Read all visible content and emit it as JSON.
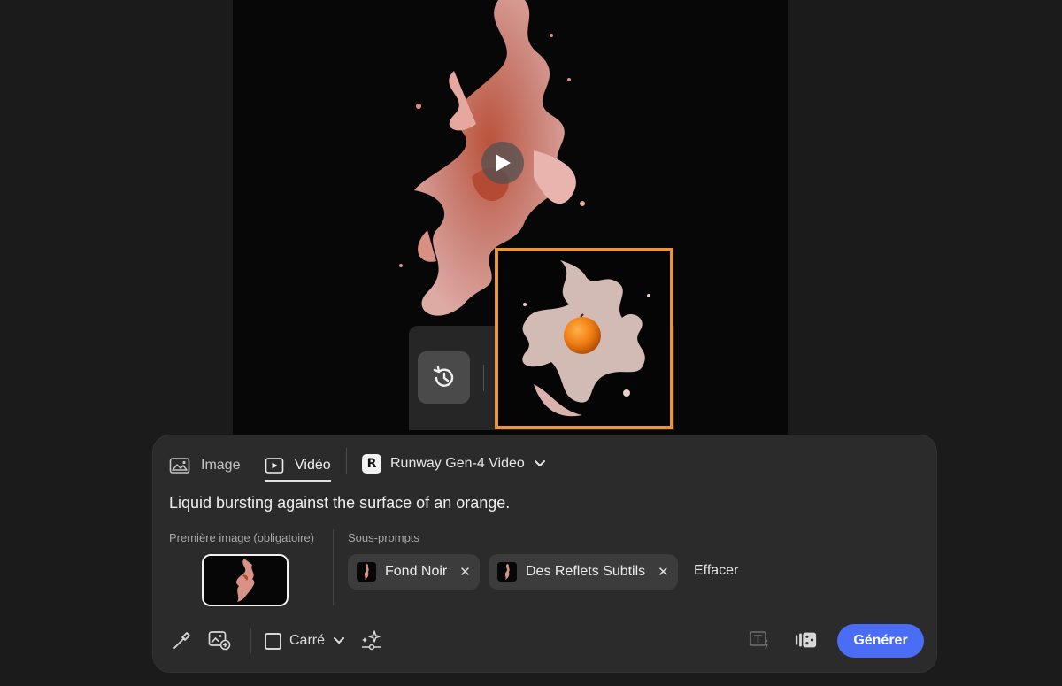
{
  "tabs": [
    {
      "label": "Image",
      "icon": "image-icon",
      "active": false
    },
    {
      "label": "Vidéo",
      "icon": "video-icon",
      "active": true
    }
  ],
  "model": {
    "name": "Runway Gen-4 Video",
    "logo": "runway-logo-icon"
  },
  "prompt": {
    "text": "Liquid bursting against the surface of an orange."
  },
  "first_image": {
    "label": "Première image (obligatoire)"
  },
  "subprompts": {
    "label": "Sous-prompts",
    "chips": [
      {
        "label": "Fond Noir"
      },
      {
        "label": "Des Reflets Subtils"
      }
    ],
    "clear_label": "Effacer"
  },
  "toolbar": {
    "ratio_label": "Carré",
    "generate_label": "Générer"
  },
  "colors": {
    "accent": "#4b6cf5",
    "selection_border": "#e8963c",
    "panel_bg": "#2b2b2b",
    "page_bg": "#1b1b1b"
  }
}
